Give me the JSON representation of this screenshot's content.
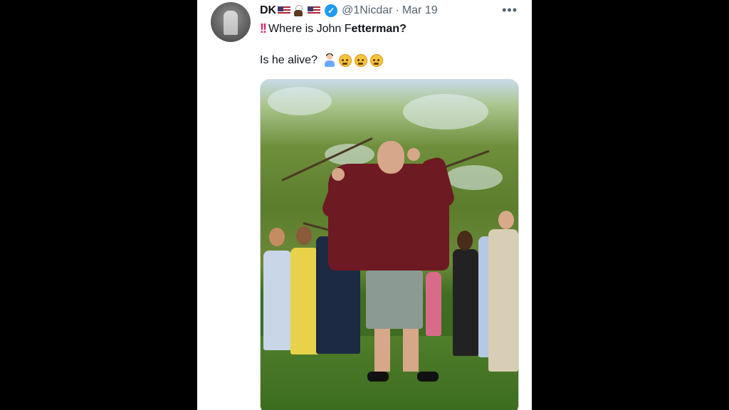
{
  "tweet": {
    "display_name": "DK",
    "handle": "@1Nicdar",
    "separator": "·",
    "date": "Mar 19",
    "more_label": "•••",
    "text_line1_prefix": "Where is John F",
    "text_line1_bold": "etterman?",
    "text_line2": "Is he alive?",
    "icons": [
      "us-flag-icon",
      "eagle-icon",
      "us-flag-icon",
      "verified-badge-icon",
      "double-exclamation-icon",
      "person-shrugging-icon",
      "raised-eyebrow-face-icon"
    ],
    "verified_symbol": "✓",
    "exclaim_symbol": "!!",
    "accent_color": "#1d9bf0",
    "secondary_text_color": "#536471"
  }
}
